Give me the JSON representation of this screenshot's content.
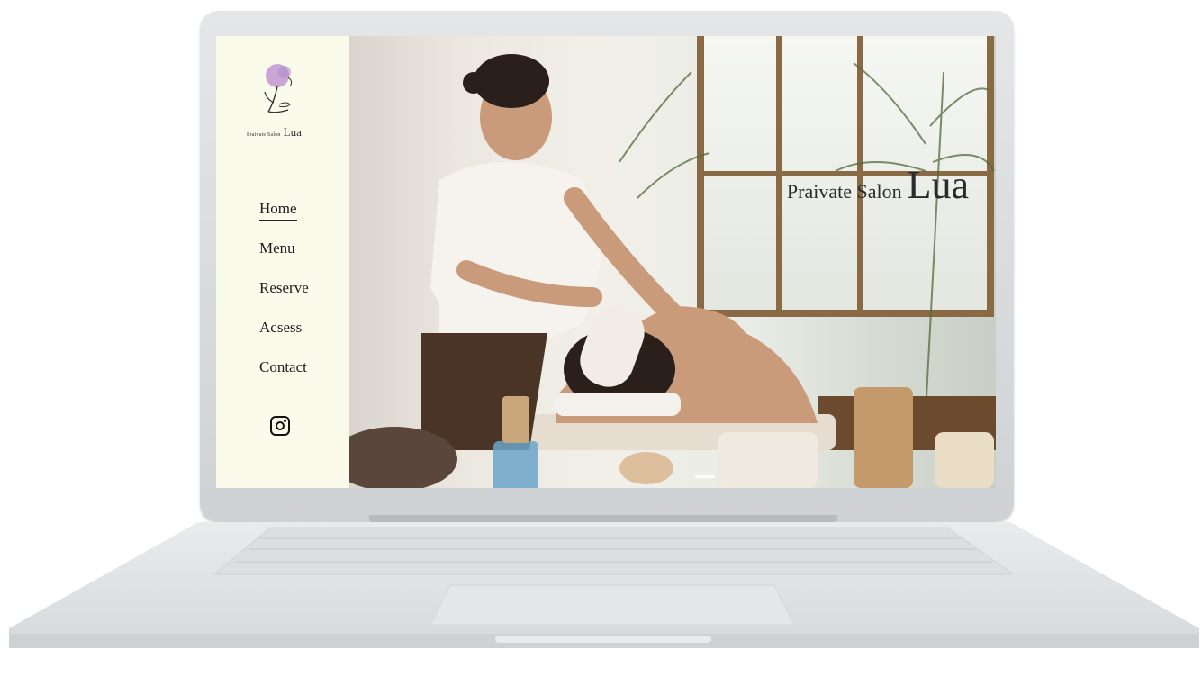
{
  "logo": {
    "small": "Praivate Salon",
    "big": "Lua"
  },
  "nav": {
    "items": [
      {
        "label": "Home"
      },
      {
        "label": "Menu"
      },
      {
        "label": "Reserve"
      },
      {
        "label": "Acsess"
      },
      {
        "label": "Contact"
      }
    ]
  },
  "social": {
    "icon": "instagram-icon"
  },
  "hero": {
    "title_small": "Praivate Salon",
    "title_big": "Lua",
    "image": "massage-salon-photo"
  },
  "colors": {
    "sidebar_bg": "#fbfbec",
    "logo_flower": "#c9a6d6",
    "text": "#1d1d1d"
  }
}
